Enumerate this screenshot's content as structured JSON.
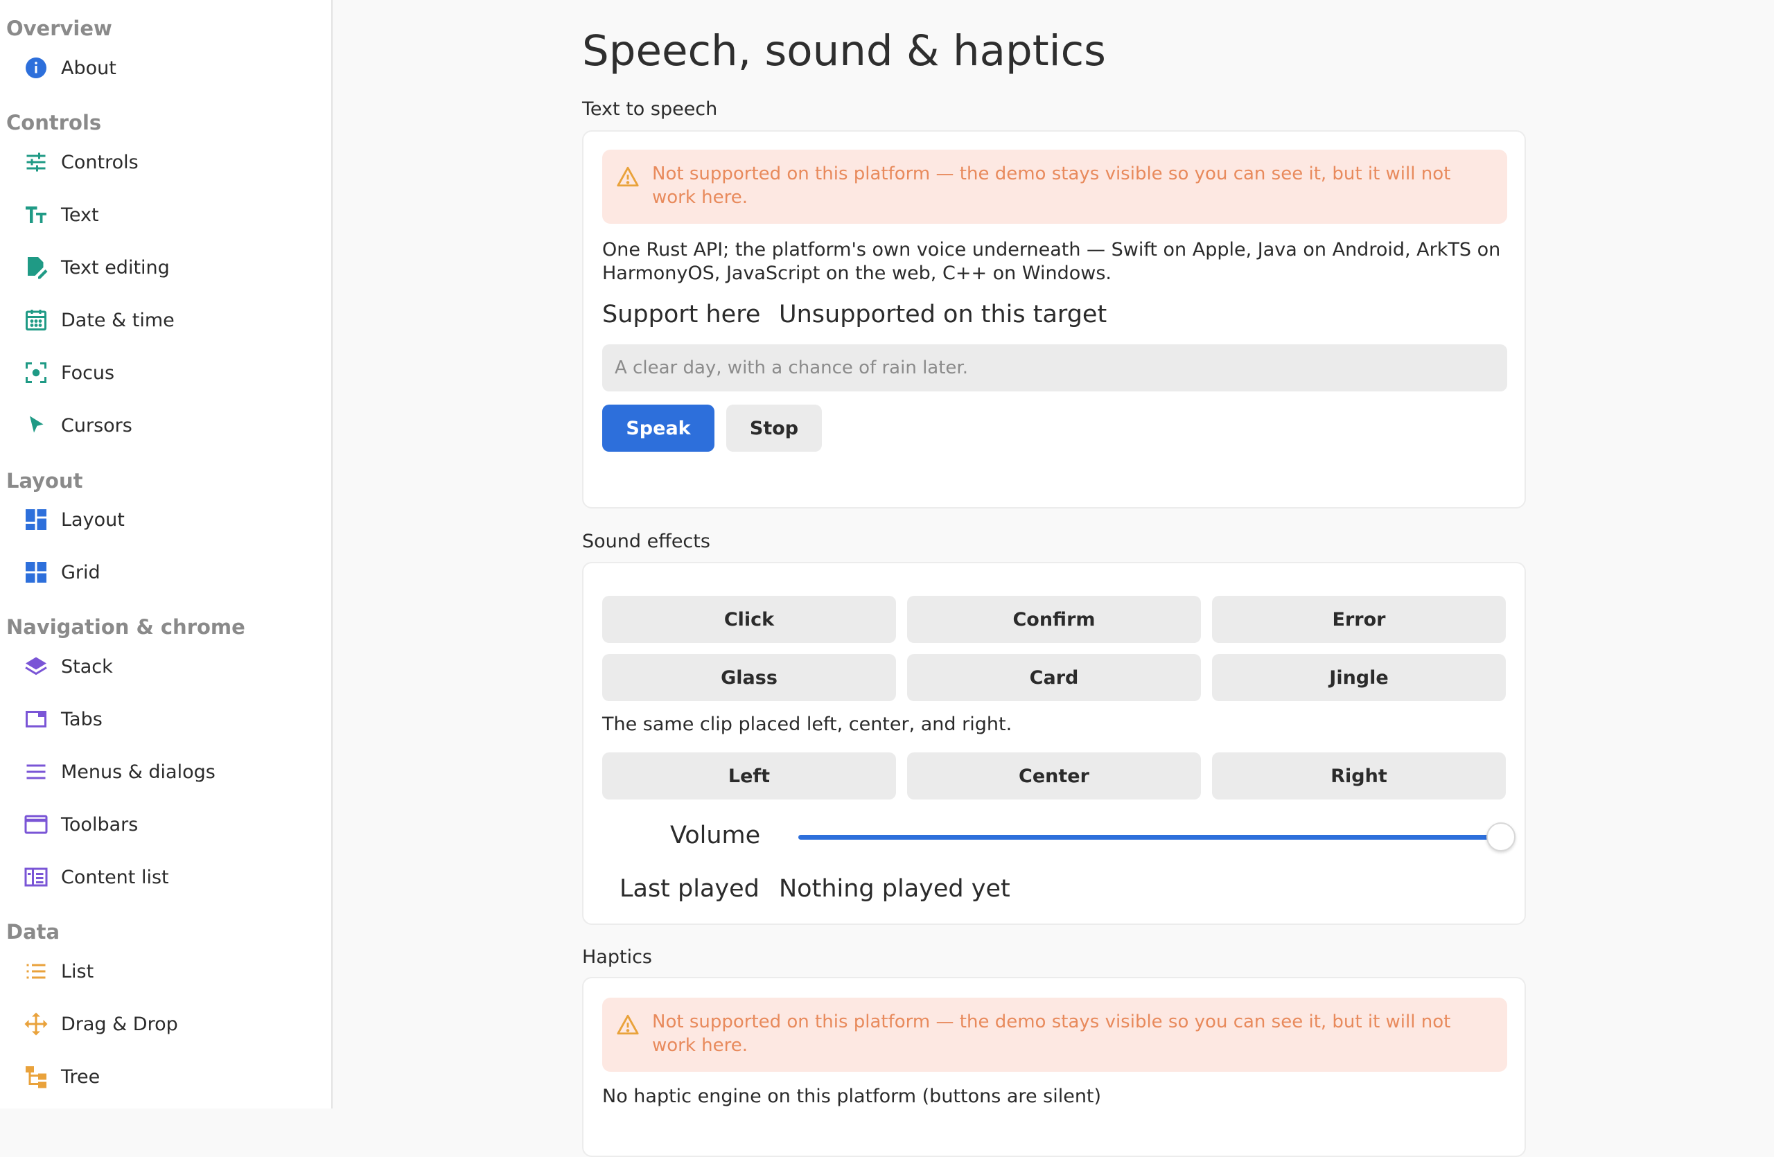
{
  "sidebar": {
    "sections": [
      {
        "title": "Overview",
        "items": [
          {
            "label": "About",
            "icon": "info-icon"
          }
        ]
      },
      {
        "title": "Controls",
        "items": [
          {
            "label": "Controls",
            "icon": "sliders-icon"
          },
          {
            "label": "Text",
            "icon": "text-size-icon"
          },
          {
            "label": "Text editing",
            "icon": "edit-document-icon"
          },
          {
            "label": "Date & time",
            "icon": "calendar-icon"
          },
          {
            "label": "Focus",
            "icon": "focus-icon"
          },
          {
            "label": "Cursors",
            "icon": "cursor-icon"
          }
        ]
      },
      {
        "title": "Layout",
        "items": [
          {
            "label": "Layout",
            "icon": "layout-grid-icon"
          },
          {
            "label": "Grid",
            "icon": "grid-icon"
          }
        ]
      },
      {
        "title": "Navigation & chrome",
        "items": [
          {
            "label": "Stack",
            "icon": "stack-layers-icon"
          },
          {
            "label": "Tabs",
            "icon": "tabs-icon"
          },
          {
            "label": "Menus & dialogs",
            "icon": "menu-lines-icon"
          },
          {
            "label": "Toolbars",
            "icon": "window-icon"
          },
          {
            "label": "Content list",
            "icon": "content-list-icon"
          }
        ]
      },
      {
        "title": "Data",
        "items": [
          {
            "label": "List",
            "icon": "list-icon"
          },
          {
            "label": "Drag & Drop",
            "icon": "move-arrows-icon"
          },
          {
            "label": "Tree",
            "icon": "tree-icon"
          }
        ]
      }
    ]
  },
  "main": {
    "title": "Speech, sound & haptics",
    "tts": {
      "group_label": "Text to speech",
      "warning": "Not supported on this platform — the demo stays visible so you can see it, but it will not work here.",
      "description": "One Rust API; the platform's own voice underneath — Swift on Apple, Java on Android, ArkTS on HarmonyOS, JavaScript on the web, C++ on Windows.",
      "support_label": "Support here",
      "support_value": "Unsupported on this target",
      "input_placeholder": "A clear day, with a chance of rain later.",
      "speak_label": "Speak",
      "stop_label": "Stop"
    },
    "sound": {
      "group_label": "Sound effects",
      "buttons_row1": [
        "Click",
        "Confirm",
        "Error"
      ],
      "buttons_row2": [
        "Glass",
        "Card",
        "Jingle"
      ],
      "pan_description": "The same clip placed left, center, and right.",
      "pan_buttons": [
        "Left",
        "Center",
        "Right"
      ],
      "volume_label": "Volume",
      "volume_value": 1.0,
      "last_played_label": "Last played",
      "last_played_value": "Nothing played yet"
    },
    "haptics": {
      "group_label": "Haptics",
      "warning": "Not supported on this platform — the demo stays visible so you can see it, but it will not work here.",
      "description": "No haptic engine on this platform (buttons are silent)"
    }
  },
  "colors": {
    "accent": "#2d6fdb",
    "warning_bg": "#fde8e2",
    "warning_text": "#e88a5c",
    "teal_icon": "#1f9a85",
    "blue_icon": "#2d6fdb",
    "purple_icon": "#7a55d6",
    "orange_icon": "#e9a23b"
  }
}
